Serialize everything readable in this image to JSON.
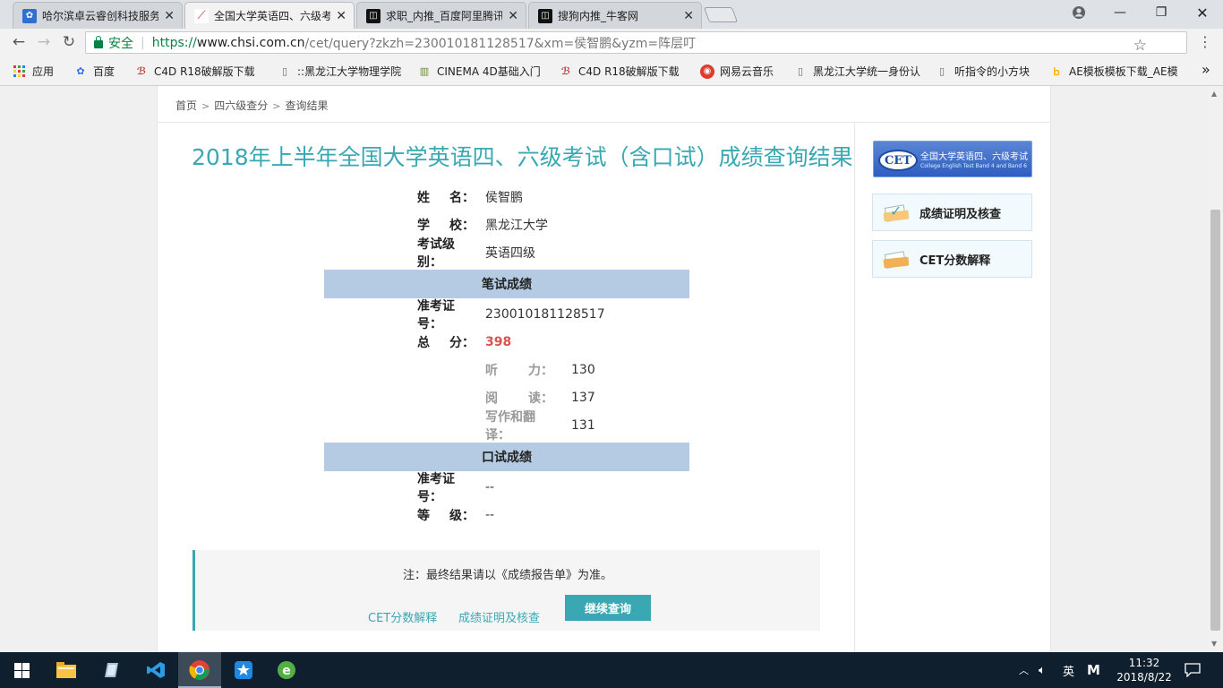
{
  "browser": {
    "tabs": [
      {
        "title": "哈尔滨卓云睿创科技服务",
        "favicon": "paw-icon"
      },
      {
        "title": "全国大学英语四、六级考",
        "favicon": "chsi-icon",
        "active": true
      },
      {
        "title": "求职_内推_百度阿里腾讯",
        "favicon": "nowcoder-icon"
      },
      {
        "title": "搜狗内推_牛客网",
        "favicon": "nowcoder-icon"
      }
    ],
    "security_label": "安全",
    "url_scheme": "https://",
    "url_host": "www.chsi.com.cn",
    "url_path": "/cet/query?zkzh=230010181128517&xm=侯智鹏&yzm=阵层叮",
    "bookmarks": [
      {
        "label": "应用",
        "icon": "apps-grid-icon"
      },
      {
        "label": "百度",
        "icon": "baidu-paw-icon"
      },
      {
        "label": "C4D R18破解版下载",
        "icon": "b-logo-icon"
      },
      {
        "label": "::黑龙江大学物理学院",
        "icon": "page-icon"
      },
      {
        "label": "CINEMA 4D基础入门",
        "icon": "book-icon"
      },
      {
        "label": "C4D R18破解版下载",
        "icon": "b-logo-icon"
      },
      {
        "label": "网易云音乐",
        "icon": "netease-music-icon"
      },
      {
        "label": "黑龙江大学统一身份认",
        "icon": "page-icon"
      },
      {
        "label": "听指令的小方块",
        "icon": "page-icon"
      },
      {
        "label": "AE模板模板下载_AE模",
        "icon": "bing-icon"
      }
    ],
    "more_bookmarks": "»"
  },
  "page": {
    "breadcrumb": [
      "首页",
      "四六级查分",
      "查询结果"
    ],
    "title": "2018年上半年全国大学英语四、六级考试（含口试）成绩查询结果",
    "info": {
      "name_label": [
        "姓",
        "名："
      ],
      "name": "侯智鹏",
      "school_label": [
        "学",
        "校："
      ],
      "school": "黑龙江大学",
      "level_label": "考试级别：",
      "level": "英语四级"
    },
    "written": {
      "header": "笔试成绩",
      "ticket_label": "准考证号：",
      "ticket": "230010181128517",
      "total_label": [
        "总",
        "分："
      ],
      "total": "398",
      "listening_label": [
        "听",
        "力："
      ],
      "listening": "130",
      "reading_label": [
        "阅",
        "读："
      ],
      "reading": "137",
      "writing_label": "写作和翻译：",
      "writing": "131"
    },
    "oral": {
      "header": "口试成绩",
      "ticket_label": "准考证号：",
      "ticket": "--",
      "grade_label": [
        "等",
        "级："
      ],
      "grade": "--"
    },
    "note": {
      "text": "注：最终结果请以《成绩报告单》为准。",
      "link1": "CET分数解释",
      "link2": "成绩证明及核查",
      "button": "继续查询"
    },
    "sidebar": {
      "banner_line1": "全国大学英语四、六级考试",
      "banner_line2": "College English Test Band 4 and Band 6",
      "banner_logo": "CET",
      "btn1": "成绩证明及核查",
      "btn2": "CET分数解释"
    }
  },
  "taskbar": {
    "lang": "英",
    "ime": "M",
    "time": "11:32",
    "date": "2018/8/22"
  }
}
